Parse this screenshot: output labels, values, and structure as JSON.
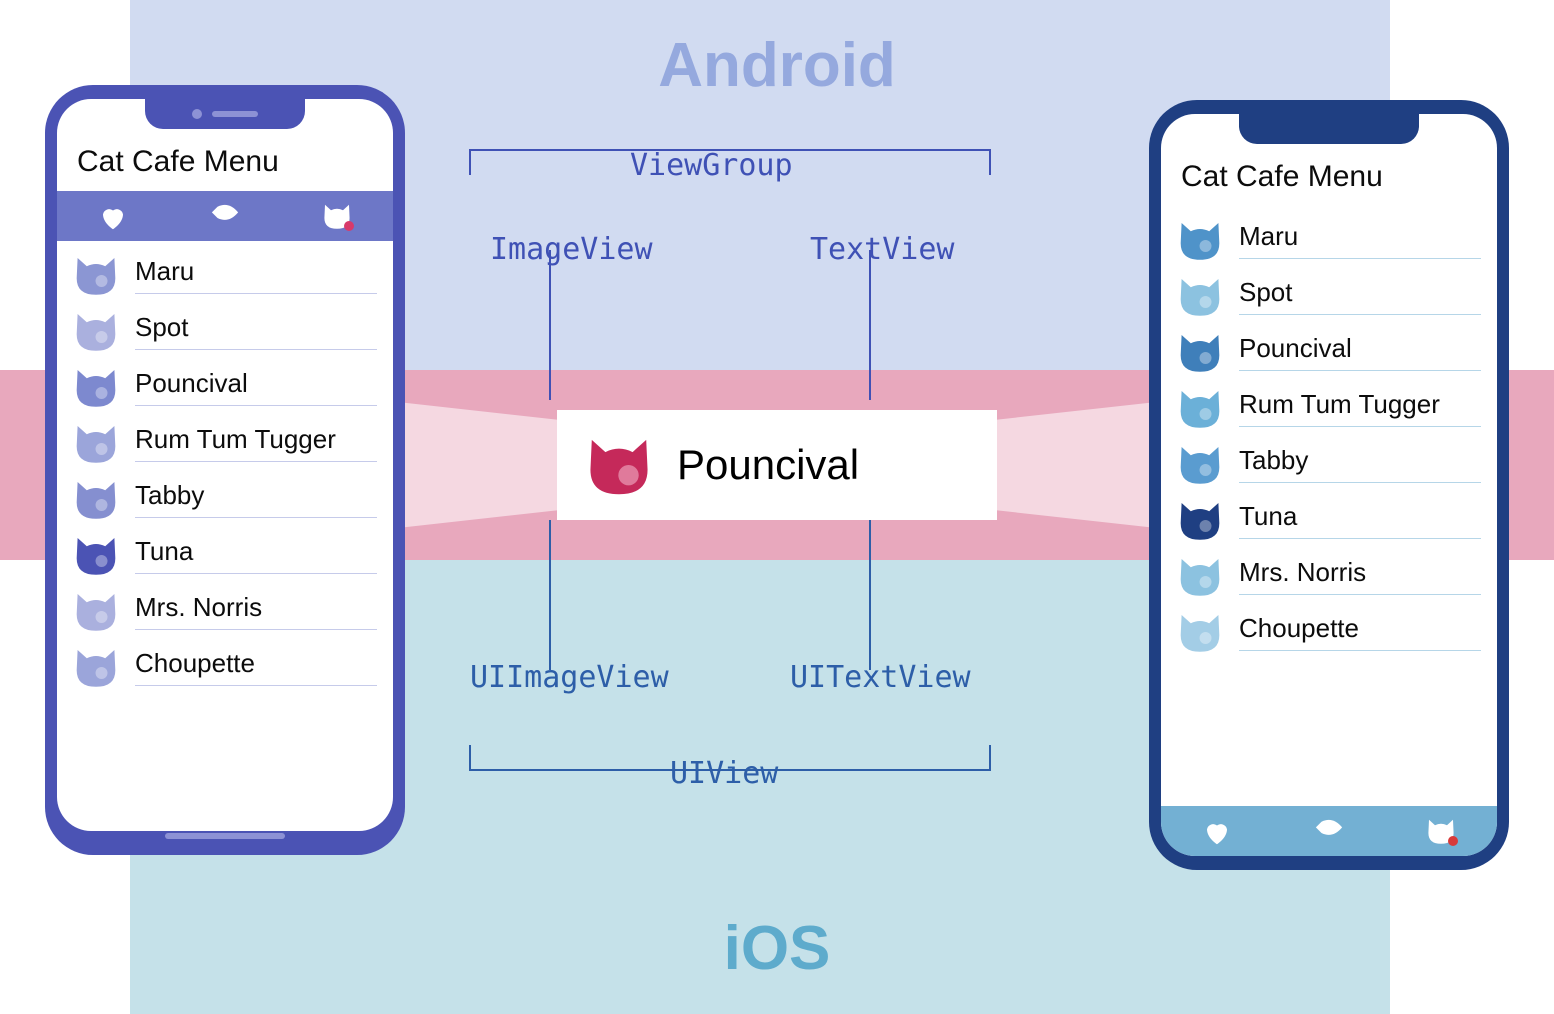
{
  "platforms": {
    "android_label": "Android",
    "ios_label": "iOS"
  },
  "tech_labels": {
    "viewgroup": "ViewGroup",
    "imageview": "ImageView",
    "textview": "TextView",
    "uiimageview": "UIImageView",
    "uitextview": "UITextView",
    "uiview": "UIView"
  },
  "callout": {
    "name": "Pouncival"
  },
  "app": {
    "title": "Cat Cafe Menu",
    "tabs": [
      "heart",
      "fish",
      "cat"
    ],
    "cats": [
      {
        "name": "Maru"
      },
      {
        "name": "Spot"
      },
      {
        "name": "Pouncival"
      },
      {
        "name": "Rum Tum Tugger"
      },
      {
        "name": "Tabby"
      },
      {
        "name": "Tuna"
      },
      {
        "name": "Mrs. Norris"
      },
      {
        "name": "Choupette"
      }
    ]
  },
  "android_cat_colors": [
    "#8b96d3",
    "#aab0de",
    "#7d89cf",
    "#9ba5da",
    "#858fd0",
    "#4b53b4",
    "#aab0de",
    "#9ba5da"
  ],
  "ios_cat_colors": [
    "#4f93c9",
    "#8cc2e0",
    "#3f7fba",
    "#6bb0d8",
    "#5a9cd0",
    "#1f3f82",
    "#8cc2e0",
    "#a3cde6"
  ]
}
